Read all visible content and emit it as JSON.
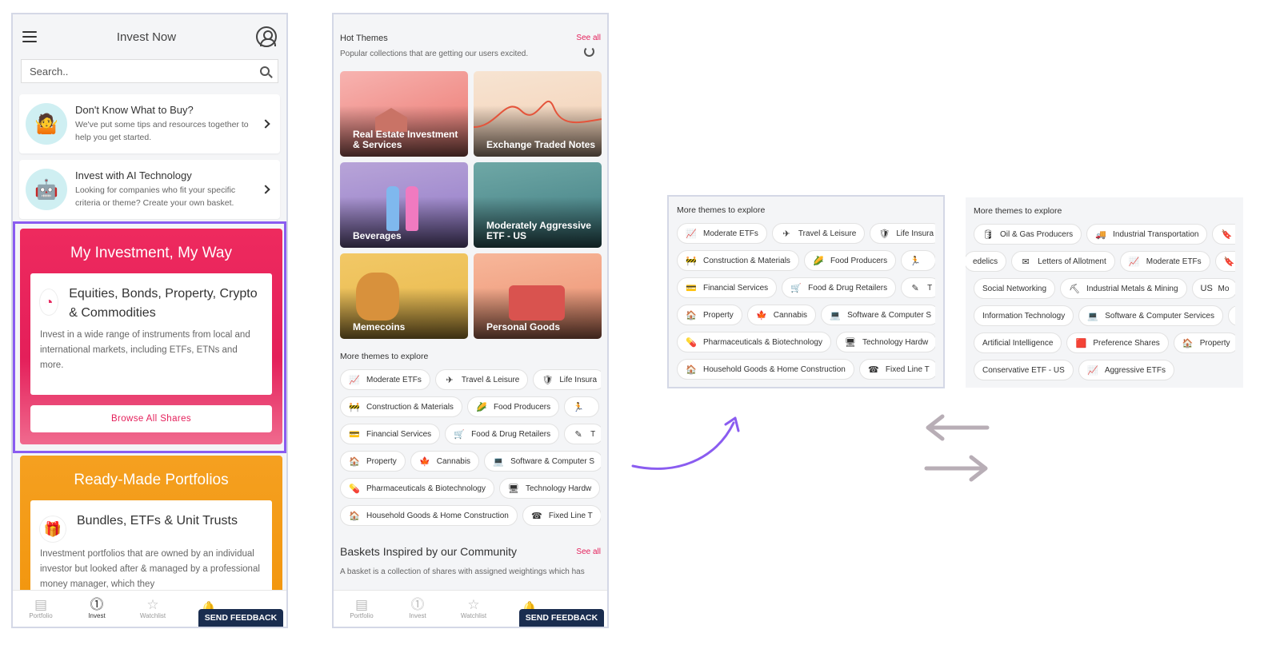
{
  "phone1": {
    "header_title": "Invest Now",
    "search_placeholder": "Search..",
    "cards": [
      {
        "title": "Don't Know What to Buy?",
        "desc": "We've put some tips and resources together to help you get started."
      },
      {
        "title": "Invest with AI Technology",
        "desc": "Looking for companies who fit your specific criteria or theme? Create your own basket."
      }
    ],
    "my_investment": {
      "title": "My Investment, My Way",
      "heading": "Equities, Bonds, Property, Crypto & Commodities",
      "desc": "Invest in a wide range of instruments from local and international markets, including ETFs, ETNs and more.",
      "button": "Browse All Shares"
    },
    "ready_made": {
      "title": "Ready-Made Portfolios",
      "heading": "Bundles, ETFs & Unit Trusts",
      "desc": "Investment portfolios that are owned by an individual investor but looked after & managed by a professional money manager, which they"
    }
  },
  "nav": {
    "items": [
      "Portfolio",
      "Invest",
      "Watchlist"
    ],
    "feedback": "SEND FEEDBACK"
  },
  "phone2": {
    "hot_themes_title": "Hot Themes",
    "see_all": "See all",
    "hot_themes_sub": "Popular collections that are getting our users excited.",
    "tiles": [
      "Real Estate Investment & Services",
      "Exchange Traded Notes",
      "Beverages",
      "Moderately Aggressive ETF - US",
      "Memecoins",
      "Personal Goods"
    ],
    "more_themes_title": "More themes to explore",
    "community_title": "Baskets Inspired by our Community",
    "community_desc": "A basket is a collection of shares with assigned weightings which has"
  },
  "chips_left": [
    [
      "Moderate ETFs",
      "Travel & Leisure",
      "Life Insura"
    ],
    [
      "Construction & Materials",
      "Food Producers",
      ""
    ],
    [
      "Financial Services",
      "Food & Drug Retailers",
      "T"
    ],
    [
      "Property",
      "Cannabis",
      "Software & Computer S"
    ],
    [
      "Pharmaceuticals & Biotechnology",
      "Technology Hardw"
    ],
    [
      "Household Goods & Home Construction",
      "Fixed Line T"
    ]
  ],
  "panel_right": {
    "title": "More themes to explore",
    "rows": [
      [
        "Oil & Gas Producers",
        "Industrial Transportation",
        ""
      ],
      [
        "edelics",
        "Letters of Allotment",
        "Moderate ETFs",
        ""
      ],
      [
        "Social Networking",
        "Industrial Metals & Mining",
        "Mo"
      ],
      [
        "Information Technology",
        "Software & Computer Services",
        ""
      ],
      [
        "Artificial Intelligence",
        "Preference Shares",
        "Property"
      ],
      [
        "Conservative ETF - US",
        "Aggressive ETFs"
      ]
    ]
  },
  "colors": {
    "accent_pink": "#e41f5a",
    "accent_orange": "#f2950d",
    "highlight_purple": "#8a5cf0",
    "feedback_navy": "#1a2d4f"
  }
}
